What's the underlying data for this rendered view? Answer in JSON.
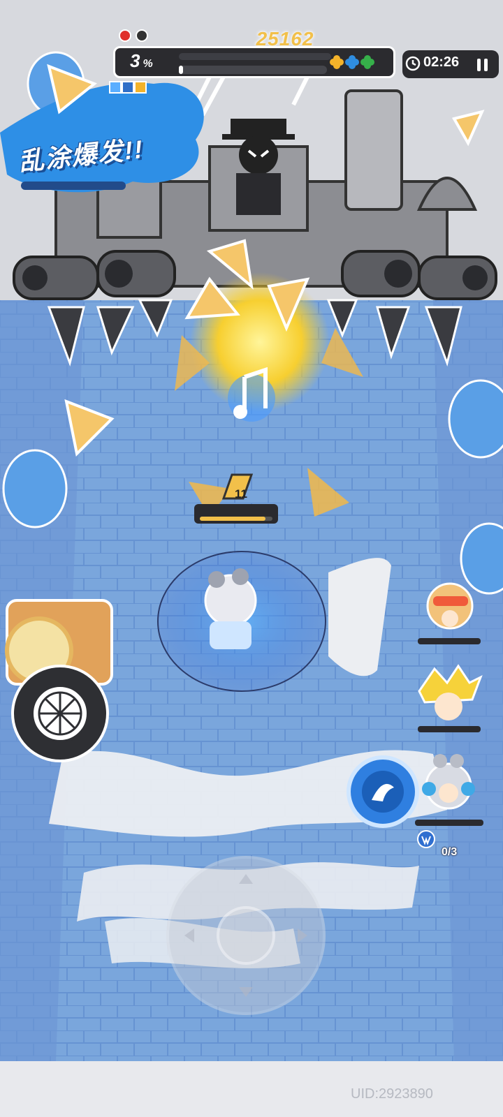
{
  "hud": {
    "score": "25162",
    "progress_percent_label": "3",
    "progress_unit": "%",
    "progress_fraction": 0.03,
    "timer": "02:26",
    "lives": [
      {
        "color": "#e0302b"
      },
      {
        "color": "#333333"
      }
    ],
    "team_colors": [
      "#f4b32a",
      "#2f8de0",
      "#36b04a"
    ]
  },
  "event_banner": {
    "text": "乱涂爆发!!",
    "color": "#2e8fe6"
  },
  "player": {
    "level": "11",
    "hp_fraction": 0.9
  },
  "skill": {
    "charges": "0/3"
  },
  "allies": [
    {
      "name": "ally-blonde-sunglasses"
    },
    {
      "name": "ally-yellow-spiky"
    },
    {
      "name": "ally-silver-headphones"
    }
  ],
  "footer": {
    "uid": "UID:2923890"
  },
  "palette": {
    "floor": "#7aa6dc",
    "tile_line": "#5e8ccc",
    "paint": "#2e8fe6",
    "accent": "#f2c04a"
  }
}
